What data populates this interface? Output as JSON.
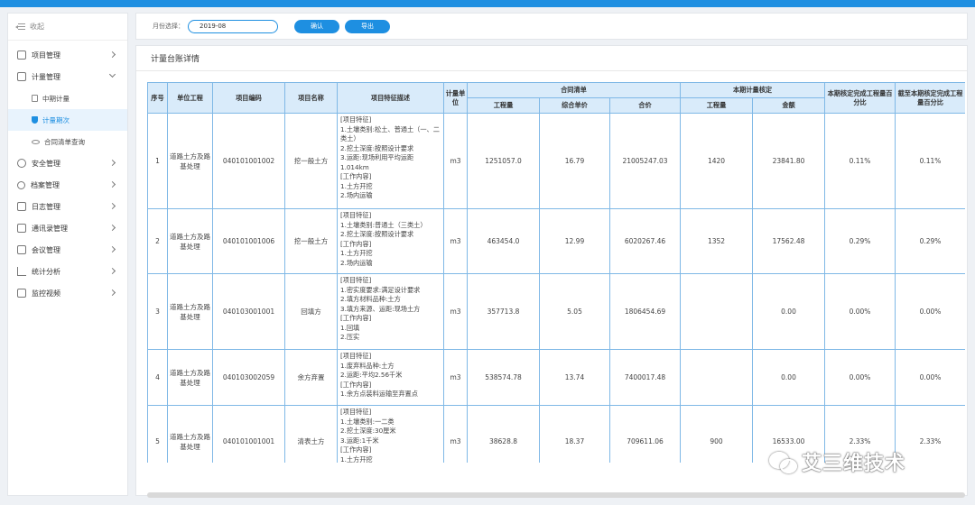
{
  "sidebar": {
    "collapse_label": "收起",
    "items": [
      {
        "label": "项目管理"
      },
      {
        "label": "计量管理",
        "expanded": true
      },
      {
        "label": "安全管理"
      },
      {
        "label": "档案管理"
      },
      {
        "label": "日志管理"
      },
      {
        "label": "通讯录管理"
      },
      {
        "label": "会议管理"
      },
      {
        "label": "统计分析"
      },
      {
        "label": "监控视频"
      }
    ],
    "sub_items": [
      {
        "label": "中期计量"
      },
      {
        "label": "计量期次",
        "active": true
      },
      {
        "label": "合同清单查询"
      }
    ]
  },
  "filter": {
    "label": "月份选择：",
    "month_value": "2019-08",
    "confirm_label": "确认",
    "export_label": "导出"
  },
  "main": {
    "title": "计量台账详情"
  },
  "table": {
    "headers": {
      "no": "序号",
      "unit_work": "单位工程",
      "code": "项目编码",
      "name": "项目名称",
      "desc": "项目特征描述",
      "unit": "计量单位",
      "contract": "合同清单",
      "qty": "工程量",
      "price": "综合单价",
      "total": "合价",
      "period": "本期计量核定",
      "p_qty": "工程量",
      "p_amount": "金额",
      "pct_period": "本期核定完成工程量百分比",
      "pct_cum": "截至本期核定完成工程量百分比"
    },
    "rows": [
      {
        "no": "1",
        "unit_work": "道路土方及路基处理",
        "code": "040101001002",
        "name": "挖一般土方",
        "desc": "[项目特征]\n1.土壤类别:松土、普通土（一、二类土）\n2.挖土深度:按照设计要求\n3.运距:现场利用平均运距1.014km\n[工作内容]\n1.土方开挖\n2.场内运输",
        "unit": "m3",
        "qty": "1251057.0",
        "price": "16.79",
        "total": "21005247.03",
        "p_qty": "1420",
        "p_amount": "23841.80",
        "pct_period": "0.11%",
        "pct_cum": "0.11%"
      },
      {
        "no": "2",
        "unit_work": "道路土方及路基处理",
        "code": "040101001006",
        "name": "挖一般土方",
        "desc": "[项目特征]\n1.土壤类别:普通土（三类土）\n2.挖土深度:按照设计要求\n[工作内容]\n1.土方开挖\n2.场内运输",
        "unit": "m3",
        "qty": "463454.0",
        "price": "12.99",
        "total": "6020267.46",
        "p_qty": "1352",
        "p_amount": "17562.48",
        "pct_period": "0.29%",
        "pct_cum": "0.29%"
      },
      {
        "no": "3",
        "unit_work": "道路土方及路基处理",
        "code": "040103001001",
        "name": "回填方",
        "desc": "[项目特征]\n1.密实度要求:满足设计要求\n2.填方材料品种:土方\n3.填方来源、运距:现场土方\n[工作内容]\n1.回填\n2.压实",
        "unit": "m3",
        "qty": "357713.8",
        "price": "5.05",
        "total": "1806454.69",
        "p_qty": "",
        "p_amount": "0.00",
        "pct_period": "0.00%",
        "pct_cum": "0.00%"
      },
      {
        "no": "4",
        "unit_work": "道路土方及路基处理",
        "code": "040103002059",
        "name": "余方弃置",
        "desc": "[项目特征]\n1.废弃料品种:土方\n2.运距:平均2.56千米\n[工作内容]\n1.余方点装料运输至弃置点",
        "unit": "m3",
        "qty": "538574.78",
        "price": "13.74",
        "total": "7400017.48",
        "p_qty": "",
        "p_amount": "0.00",
        "pct_period": "0.00%",
        "pct_cum": "0.00%"
      },
      {
        "no": "5",
        "unit_work": "道路土方及路基处理",
        "code": "040101001001",
        "name": "清表土方",
        "desc": "[项目特征]\n1.土壤类别:一二类\n2.挖土深度:30厘米\n3.运距:1千米\n[工作内容]\n1.土方开挖",
        "unit": "m3",
        "qty": "38628.8",
        "price": "18.37",
        "total": "709611.06",
        "p_qty": "900",
        "p_amount": "16533.00",
        "pct_period": "2.33%",
        "pct_cum": "2.33%"
      }
    ]
  },
  "watermark": {
    "text": "艾三维技术"
  },
  "colors": {
    "accent": "#1e8fe1",
    "header_bg": "#d9ebfa",
    "border": "#7fb8e6"
  }
}
